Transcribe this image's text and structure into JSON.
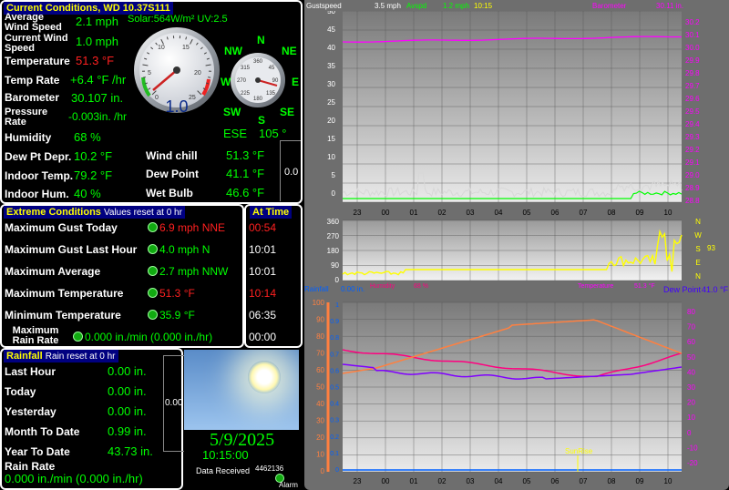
{
  "current": {
    "title": "Current Conditions, WD 10.37S111",
    "solar": "Solar:564W/m² UV:2.5",
    "avg_wind_label": "Average Wind Speed",
    "avg_wind": "2.1 mph",
    "cur_wind_label": "Current Wind Speed",
    "cur_wind": "1.0 mph",
    "temp_label": "Temperature",
    "temp": "51.3 °F",
    "temp_rate_label": "Temp Rate",
    "temp_rate": "+6.4 °F /hr",
    "baro_label": "Barometer",
    "baro": "30.107 in.",
    "press_rate_label": "Pressure Rate",
    "press_rate": "-0.003in. /hr",
    "humidity_label": "Humidity",
    "humidity": "68 %",
    "dewdep_label": "Dew Pt Depr.",
    "dewdep": "10.2 °F",
    "indoor_temp_label": "Indoor Temp.",
    "indoor_temp": "79.2 °F",
    "indoor_hum_label": "Indoor Hum.",
    "indoor_hum": "40 %",
    "windchill_label": "Wind chill",
    "windchill": "51.3 °F",
    "dewpoint_label": "Dew Point",
    "dewpoint": "41.1 °F",
    "wetbulb_label": "Wet Bulb",
    "wetbulb": "46.6 °F",
    "gauge_value": "1.0",
    "gauge_ticks": [
      "0",
      "5",
      "10",
      "15",
      "20",
      "25"
    ],
    "compass_dir": "ESE",
    "compass_deg": "105 °",
    "compass_labels": {
      "n": "N",
      "ne": "NE",
      "e": "E",
      "se": "SE",
      "s": "S",
      "sw": "SW",
      "w": "W",
      "nw": "NW"
    },
    "compass_ticks": [
      "360",
      "45",
      "90",
      "135",
      "180",
      "225",
      "270",
      "315"
    ],
    "side_value": "0.0"
  },
  "extreme": {
    "title": "Extreme Conditions",
    "subtitle": "Values reset at 0 hr",
    "time_title": "At Time",
    "rows": [
      {
        "label": "Maximum Gust Today",
        "value": "6.9 mph NNE",
        "time": "00:54",
        "red": true
      },
      {
        "label": "Maximum Gust Last Hour",
        "value": "4.0 mph   N",
        "time": "10:01",
        "red": false
      },
      {
        "label": "Maximum Average",
        "value": "2.7 mph NNW",
        "time": "10:01",
        "red": false
      },
      {
        "label": "Maximum Temperature",
        "value": "51.3 °F",
        "time": "10:14",
        "red": true
      },
      {
        "label": "Minimum Temperature",
        "value": "35.9 °F",
        "time": "06:35",
        "red": false
      },
      {
        "label": "Maximum Rain Rate",
        "value": "0.000 in./min (0.000 in./hr)",
        "time": "00:00",
        "red": false
      }
    ]
  },
  "rain": {
    "title": "Rainfall",
    "subtitle": "Rain reset at 0 hr",
    "rows": [
      {
        "label": "Last Hour",
        "value": "0.00 in."
      },
      {
        "label": "Today",
        "value": "0.00 in."
      },
      {
        "label": "Yesterday",
        "value": "0.00 in."
      },
      {
        "label": "Month To Date",
        "value": "0.99 in."
      },
      {
        "label": "Year To Date",
        "value": "43.73 in."
      }
    ],
    "rate_label": "Rain Rate",
    "rate": "0.000 in./min (0.000 in./hr)",
    "side_value": "0.00"
  },
  "status": {
    "date": "5/9/2025",
    "time": "10:15:00",
    "data_received_label": "Data Received",
    "data_received": "4462136",
    "alarm_label": "Alarm"
  },
  "graphs": {
    "top": {
      "legend_gust": "Gustspeed",
      "legend_gust_val": "3.5 mph",
      "legend_avg": "Avspd",
      "legend_avg_val": "1.2 mph",
      "legend_time": "10:15",
      "legend_baro": "Barometer",
      "legend_baro_val": "30.11 in.",
      "left_ticks": [
        "50",
        "45",
        "40",
        "35",
        "30",
        "25",
        "20",
        "15",
        "10",
        "5",
        "0"
      ],
      "right_ticks": [
        "30.2",
        "30.1",
        "30.0",
        "29.9",
        "29.8",
        "29.7",
        "29.6",
        "29.5",
        "29.4",
        "29.3",
        "29.2",
        "29.1",
        "29.0",
        "28.9",
        "28.8"
      ],
      "x_ticks": [
        "23",
        "00",
        "01",
        "02",
        "03",
        "04",
        "05",
        "06",
        "07",
        "08",
        "09",
        "10"
      ]
    },
    "mid": {
      "left_ticks": [
        "360",
        "270",
        "180",
        "90",
        "0"
      ],
      "dir_letters": [
        "N",
        "W",
        "S",
        "E",
        "N"
      ],
      "dir_value": "93",
      "humidity_label": "Humidity",
      "humidity_val": "68 %",
      "temp_label": "Temperature",
      "temp_val": "51.3 °F"
    },
    "bottom": {
      "rain_label": "Rainfall",
      "rain_val": "0.00 in.",
      "dew_label": "Dew Point",
      "dew_val": "41.0 °F",
      "left_ticks": [
        "100",
        "90",
        "80",
        "70",
        "60",
        "50",
        "40",
        "30",
        "20",
        "10",
        "0"
      ],
      "inner_ticks": [
        "1",
        "0.9",
        "0.8",
        "0.7",
        "0.6",
        "0.5",
        "0.4",
        "0.3",
        "0.2",
        "0.1",
        "0"
      ],
      "right_ticks": [
        "80",
        "70",
        "60",
        "50",
        "40",
        "30",
        "20",
        "10",
        "0",
        "-10",
        "-20"
      ],
      "x_ticks": [
        "23",
        "00",
        "01",
        "02",
        "03",
        "04",
        "05",
        "06",
        "07",
        "08",
        "09",
        "10"
      ],
      "sunrise": "SunRise"
    }
  },
  "colors": {
    "title_bg": "#000080",
    "title_fg": "#ffff00",
    "value": "#00ff00",
    "alert": "#ff2020",
    "baro_line": "#ff00ff",
    "temp_line": "#ff8040",
    "humidity_line": "#ff0080",
    "dew_line": "#8000ff",
    "winddir_line": "#ffff00"
  }
}
